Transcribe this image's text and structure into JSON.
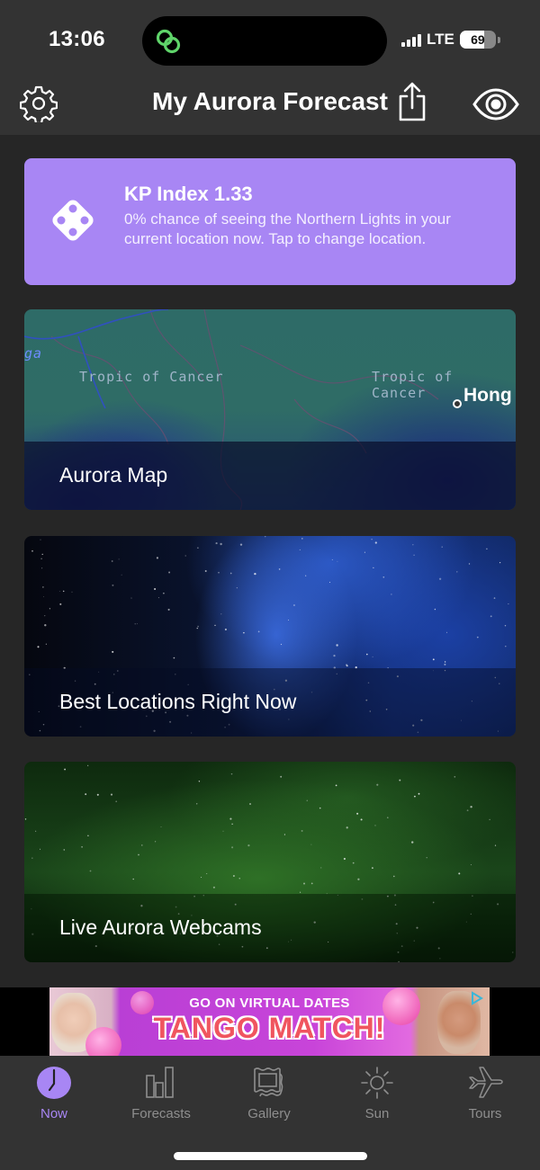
{
  "status_bar": {
    "time": "13:06",
    "network": "LTE",
    "battery_percent": "69",
    "battery_level": 0.69,
    "signal_bars_active": 4
  },
  "header": {
    "title": "My Aurora Forecast",
    "icons": [
      "gear-icon",
      "share-icon",
      "eye-icon"
    ]
  },
  "kp_card": {
    "title": "KP Index 1.33",
    "description": "0% chance of seeing the Northern Lights in your current location now. Tap to change location.",
    "icon": "dice-icon",
    "color": "#a886f4"
  },
  "features": [
    {
      "label": "Aurora Map",
      "map_labels": [
        "Tropic of Cancer",
        "Tropic of Cancer",
        "Hong",
        "ga"
      ]
    },
    {
      "label": "Best Locations Right Now"
    },
    {
      "label": "Live Aurora Webcams"
    }
  ],
  "ad": {
    "subtitle": "GO ON VIRTUAL DATES",
    "headline": "TANGO MATCH!"
  },
  "tabs": [
    {
      "label": "Now",
      "icon": "clock-icon",
      "active": true
    },
    {
      "label": "Forecasts",
      "icon": "bar-chart-icon",
      "active": false
    },
    {
      "label": "Gallery",
      "icon": "picture-frame-icon",
      "active": false
    },
    {
      "label": "Sun",
      "icon": "sun-icon",
      "active": false
    },
    {
      "label": "Tours",
      "icon": "airplane-icon",
      "active": false
    }
  ],
  "colors": {
    "accent": "#a886f4",
    "background": "#262626",
    "bar_background": "#333333",
    "inactive_tab": "#8e8e8e"
  }
}
